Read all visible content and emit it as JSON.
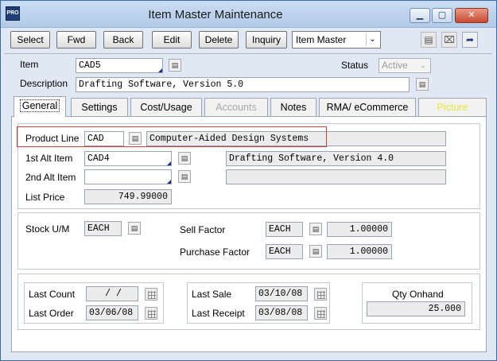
{
  "window": {
    "title": "Item Master Maintenance",
    "app_icon": "PRO",
    "minimize_glyph": "▁",
    "maximize_glyph": "▢",
    "close_glyph": "✕"
  },
  "toolbar": {
    "select_label": "Select",
    "fwd_label": "Fwd",
    "back_label": "Back",
    "edit_label": "Edit",
    "delete_label": "Delete",
    "inquiry_label": "Inquiry",
    "view_select": "Item Master",
    "icons": [
      "save-icon",
      "cancel-icon",
      "exit-icon"
    ]
  },
  "header": {
    "item_label": "Item",
    "item_value": "CAD5",
    "status_label": "Status",
    "status_value": "Active",
    "description_label": "Description",
    "description_value": "Drafting Software, Version 5.0"
  },
  "tabs": [
    {
      "label": "General",
      "state": "active"
    },
    {
      "label": "Settings",
      "state": "normal"
    },
    {
      "label": "Cost/Usage",
      "state": "normal"
    },
    {
      "label": "Accounts",
      "state": "disabled"
    },
    {
      "label": "Notes",
      "state": "normal"
    },
    {
      "label": "RMA/ eCommerce",
      "state": "normal"
    },
    {
      "label": "Picture",
      "state": "yellow"
    }
  ],
  "general": {
    "product_line_label": "Product Line",
    "product_line_code": "CAD",
    "product_line_desc": "Computer-Aided Design Systems",
    "alt1_label": "1st Alt Item",
    "alt1_code": "CAD4",
    "alt1_desc": "Drafting Software, Version 4.0",
    "alt2_label": "2nd Alt Item",
    "alt2_code": "",
    "alt2_desc": "",
    "list_price_label": "List Price",
    "list_price_value": "749.99000",
    "stock_um_label": "Stock U/M",
    "stock_um_value": "EACH",
    "sell_factor_label": "Sell Factor",
    "sell_um_value": "EACH",
    "sell_factor_value": "1.00000",
    "purchase_factor_label": "Purchase Factor",
    "purchase_um_value": "EACH",
    "purchase_factor_value": "1.00000",
    "last_count_label": "Last Count",
    "last_count_value": "/    /",
    "last_order_label": "Last Order",
    "last_order_value": "03/06/08",
    "last_sale_label": "Last Sale",
    "last_sale_value": "03/10/08",
    "last_receipt_label": "Last Receipt",
    "last_receipt_value": "03/08/08",
    "qty_onhand_label": "Qty Onhand",
    "qty_onhand_value": "25.000"
  },
  "colors": {
    "highlight_border": "#d43c3c",
    "picture_tab_text": "#e7e63a"
  }
}
